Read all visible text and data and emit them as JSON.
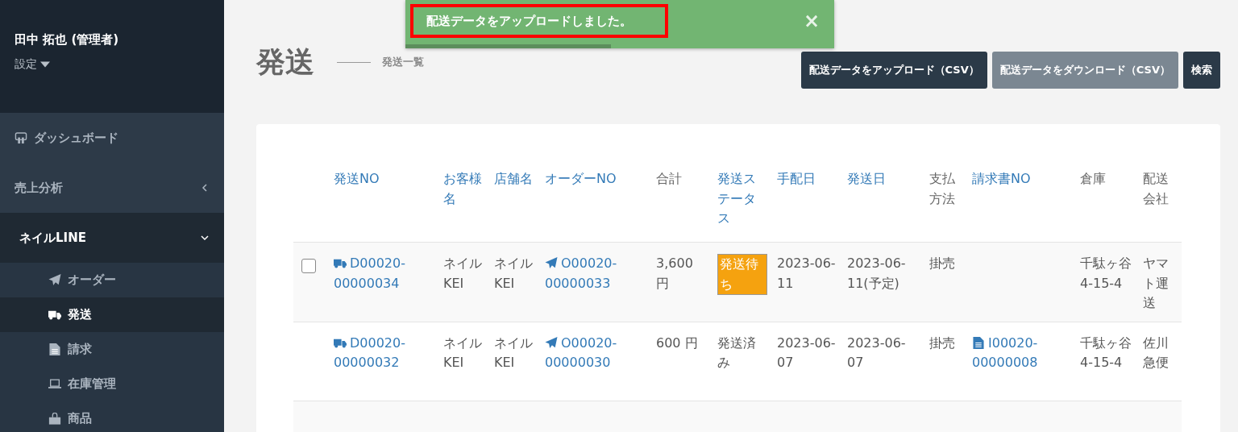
{
  "sidebar": {
    "user": "田中 拓也 (管理者)",
    "settings": "設定",
    "items": [
      {
        "label": "ダッシュボード",
        "expanded": false
      },
      {
        "label": "売上分析",
        "expanded": false
      },
      {
        "label": "ネイルLINE",
        "expanded": true,
        "children": [
          {
            "label": "オーダー",
            "selected": false
          },
          {
            "label": "発送",
            "selected": true
          },
          {
            "label": "請求",
            "selected": false
          },
          {
            "label": "在庫管理",
            "selected": false
          },
          {
            "label": "商品",
            "selected": false
          }
        ]
      }
    ]
  },
  "toast": {
    "message": "配送データをアップロードしました。",
    "close": "×",
    "progress": {
      "level": 0.48
    }
  },
  "page": {
    "title": "発送",
    "subtitle": "発送一覧"
  },
  "buttons": [
    {
      "label": "配送データをアップロード（CSV）",
      "kind": "dark"
    },
    {
      "label": "配送データをダウンロード（CSV）",
      "kind": "muted"
    },
    {
      "label": "検索",
      "kind": "dark"
    }
  ],
  "table": {
    "columns": [
      {
        "label": "発送NO",
        "sortable": true
      },
      {
        "label": "お客様名",
        "sortable": true
      },
      {
        "label": "店舗名",
        "sortable": true
      },
      {
        "label": "オーダーNO",
        "sortable": true
      },
      {
        "label": "合計",
        "sortable": false
      },
      {
        "label": "発送ステータス",
        "sortable": true
      },
      {
        "label": "手配日",
        "sortable": true
      },
      {
        "label": "発送日",
        "sortable": true
      },
      {
        "label": "支払方法",
        "sortable": false
      },
      {
        "label": "請求書NO",
        "sortable": true
      },
      {
        "label": "倉庫",
        "sortable": false
      },
      {
        "label": "配送会社",
        "sortable": false
      }
    ],
    "rows": [
      {
        "checked": false,
        "cells": [
          {
            "kind": "link",
            "text": "D00020-00000034"
          },
          {
            "kind": "text",
            "text": "ネイルKEI"
          },
          {
            "kind": "text",
            "text": "ネイルKEI"
          },
          {
            "kind": "link",
            "text": "O00020-00000033"
          },
          {
            "kind": "text",
            "text": "3,600 円"
          },
          {
            "kind": "badge",
            "text": "発送待ち"
          },
          {
            "kind": "text",
            "text": "2023-06-11"
          },
          {
            "kind": "text",
            "text": "2023-06-11(予定)"
          },
          {
            "kind": "text",
            "text": "掛売"
          },
          {
            "kind": "empty"
          },
          {
            "kind": "text",
            "text": "千駄ヶ谷4-15-4"
          },
          {
            "kind": "text",
            "text": "ヤマト運送"
          }
        ]
      },
      {
        "cells": [
          {
            "kind": "link",
            "text": "D00020-00000032"
          },
          {
            "kind": "text",
            "text": "ネイルKEI"
          },
          {
            "kind": "text",
            "text": "ネイルKEI"
          },
          {
            "kind": "link",
            "text": "O00020-00000030"
          },
          {
            "kind": "text",
            "text": "600 円"
          },
          {
            "kind": "text",
            "text": "発送済み"
          },
          {
            "kind": "text",
            "text": "2023-06-07"
          },
          {
            "kind": "text",
            "text": "2023-06-07"
          },
          {
            "kind": "text",
            "text": "掛売"
          },
          {
            "kind": "link",
            "text": "I00020-00000008"
          },
          {
            "kind": "text",
            "text": "千駄ヶ谷4-15-4"
          },
          {
            "kind": "text",
            "text": "佐川急便"
          }
        ]
      }
    ]
  }
}
